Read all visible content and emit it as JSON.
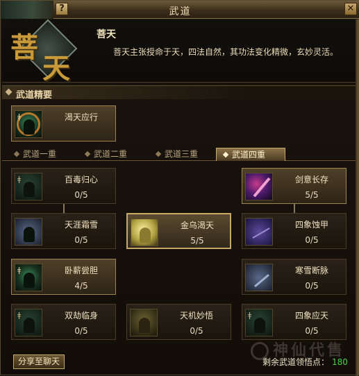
{
  "window": {
    "title": "武道",
    "help_label": "?",
    "close_label": "✕"
  },
  "header": {
    "emblem_char1": "菩",
    "emblem_char2": "天",
    "name": "菩天",
    "description": "菩天主张授命于天，四法自然，其功法变化精微，玄妙灵活。"
  },
  "essentials": {
    "label": "武道精要",
    "skill": {
      "name": "渴天应行",
      "icon": "meditation-fire-icon"
    }
  },
  "tabs": [
    {
      "label": "武道一重",
      "active": false
    },
    {
      "label": "武道二重",
      "active": false
    },
    {
      "label": "武道三重",
      "active": false
    },
    {
      "label": "武道四重",
      "active": true
    }
  ],
  "skills": {
    "baidu": {
      "name": "百毒归心",
      "level": "0/5",
      "icon": "meditation-icon"
    },
    "jianyi": {
      "name": "剑意长存",
      "level": "5/5",
      "icon": "sword-slash-icon"
    },
    "tianya": {
      "name": "天涯霜雪",
      "level": "0/5",
      "icon": "frost-icon"
    },
    "jinwu": {
      "name": "金乌渴天",
      "level": "5/5",
      "icon": "golden-crow-icon"
    },
    "sixiang_shi": {
      "name": "四象蚀甲",
      "level": "0/5",
      "icon": "fan-icon"
    },
    "woxin": {
      "name": "卧薪尝胆",
      "level": "4/5",
      "icon": "meditation-icon"
    },
    "hanxue": {
      "name": "寒雪断脉",
      "level": "0/5",
      "icon": "frost-blade-icon"
    },
    "shuangjie": {
      "name": "双劫临身",
      "level": "0/5",
      "icon": "meditation-icon"
    },
    "tianji": {
      "name": "天机妙悟",
      "level": "0/5",
      "icon": "ochre-icon"
    },
    "sixiang_ying": {
      "name": "四象应天",
      "level": "0/5",
      "icon": "meditation-icon"
    }
  },
  "footer": {
    "share_label": "分享至聊天",
    "remaining_label": "剩余武道领悟点：",
    "remaining_value": "180"
  },
  "watermark": "神仙代售"
}
